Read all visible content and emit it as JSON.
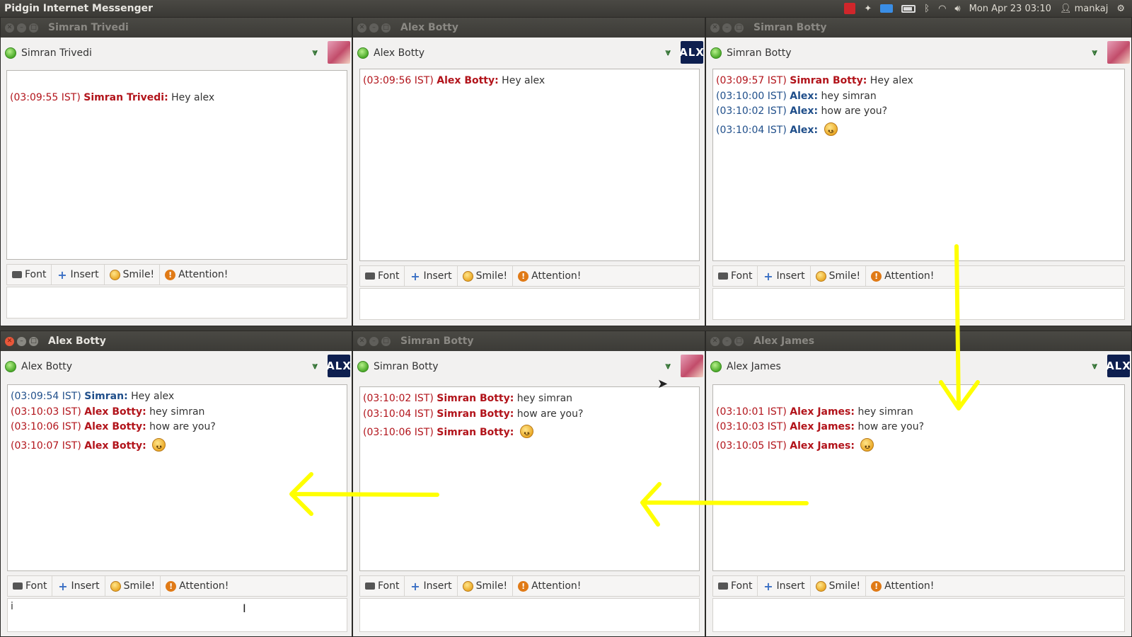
{
  "topbar": {
    "app_title": "Pidgin Internet Messenger",
    "clock": "Mon Apr 23 03:10",
    "user": "mankaj",
    "tray_icons": [
      "red-indicator-icon",
      "dropbox-icon",
      "mail-icon",
      "battery-icon",
      "bluetooth-icon",
      "wifi-icon",
      "volume-icon",
      "user-icon",
      "gear-icon"
    ]
  },
  "toolbar_labels": {
    "font": "Font",
    "insert": "Insert",
    "smile": "Smile!",
    "attention": "Attention!"
  },
  "timestamps": {
    "t0954": "(03:09:54  IST)",
    "t0955": "(03:09:55  IST)",
    "t0956": "(03:09:56  IST)",
    "t0957": "(03:09:57  IST)",
    "t1000": "(03:10:00  IST)",
    "t1001": "(03:10:01  IST)",
    "t1002": "(03:10:02  IST)",
    "t1003": "(03:10:03  IST)",
    "t1004": "(03:10:04  IST)",
    "t1005": "(03:10:05  IST)",
    "t1006": "(03:10:06  IST)",
    "t1007": "(03:10:07  IST)"
  },
  "messages": {
    "hey_alex": "Hey alex",
    "hey_simran": "hey simran",
    "how_are_you": "how are you?"
  },
  "windows": {
    "w1": {
      "title": "Simran Trivedi",
      "buddy": "Simran Trivedi",
      "sender_a": "Simran Trivedi:"
    },
    "w2": {
      "title": "Alex Botty",
      "buddy": "Alex Botty",
      "sender_a": "Alex Botty:",
      "avatar_text": "ALX"
    },
    "w3": {
      "title": "Simran Botty",
      "buddy": "Simran Botty",
      "sender_a": "Simran Botty:",
      "sender_b": "Alex:"
    },
    "w4": {
      "title": "Alex Botty",
      "buddy": "Alex Botty",
      "sender_a": "Simran:",
      "sender_b": "Alex Botty:",
      "avatar_text": "ALX",
      "entry_text": "i"
    },
    "w5": {
      "title": "Simran Botty",
      "buddy": "Simran Botty",
      "sender_a": "Simran Botty:"
    },
    "w6": {
      "title": "Alex James",
      "buddy": "Alex James",
      "sender_a": "Alex James:",
      "avatar_text": "ALX"
    }
  },
  "colors": {
    "received": "#b2141b",
    "sent": "#1f4e8a",
    "annotation_arrow": "#ffff00"
  }
}
